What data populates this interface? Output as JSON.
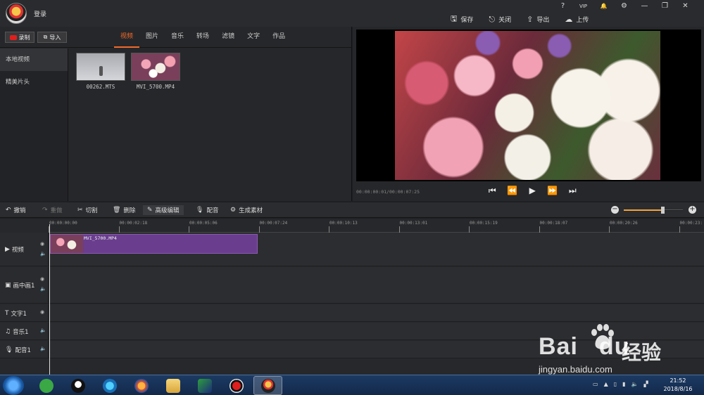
{
  "titlebar": {
    "login": "登录",
    "actions": [
      {
        "label": "保存",
        "icon": "save-icon",
        "glyph": "🖫"
      },
      {
        "label": "关闭",
        "icon": "close-doc-icon",
        "glyph": "⎋"
      },
      {
        "label": "导出",
        "icon": "export-icon",
        "glyph": "⇪"
      },
      {
        "label": "上传",
        "icon": "upload-icon",
        "glyph": "☁"
      }
    ],
    "sys": {
      "help": "?",
      "vip": "VIP",
      "bell": "🔔",
      "settings": "⚙",
      "minimize": "—",
      "restore": "❐",
      "close": "✕"
    }
  },
  "media": {
    "record_label": "录制",
    "import_label": "导入",
    "tabs": [
      "视频",
      "图片",
      "音乐",
      "转场",
      "滤镜",
      "文字",
      "作品"
    ],
    "active_tab": 0,
    "categories": [
      "本地视频",
      "精美片头"
    ],
    "active_category": 0,
    "files": [
      {
        "name": "00262.MTS",
        "thumb": "snow"
      },
      {
        "name": "MVI_5700.MP4",
        "thumb": "flower"
      }
    ]
  },
  "preview": {
    "timecode": "00:00:00:01/00:00:07:25",
    "controls": [
      "⏮",
      "⏪",
      "▶",
      "⏩",
      "⏭"
    ]
  },
  "edit_toolbar": {
    "undo": "撤销",
    "redo": "重做",
    "cut": "切割",
    "delete": "删除",
    "advanced": "高级编辑",
    "dub": "配音",
    "generate": "生成素材",
    "zoom_level": 0.65
  },
  "timeline": {
    "ticks": [
      "00:00:00:00",
      "00:00:02:18",
      "00:00:05:06",
      "00:00:07:24",
      "00:00:10:13",
      "00:00:13:01",
      "00:00:15:19",
      "00:00:18:07",
      "00:00:20:26",
      "00:00:23:"
    ],
    "tracks": {
      "video": "视频",
      "pip": "画中画1",
      "text": "文字1",
      "music": "音乐1",
      "voice": "配音1"
    },
    "clip_name": "MVI_5700.MP4"
  },
  "taskbar": {
    "time": "21:52",
    "date": "2018/8/16"
  },
  "watermark": {
    "brand": "Bai",
    "brand_end": "du",
    "cn": "经验",
    "url": "jingyan.baidu.com"
  }
}
